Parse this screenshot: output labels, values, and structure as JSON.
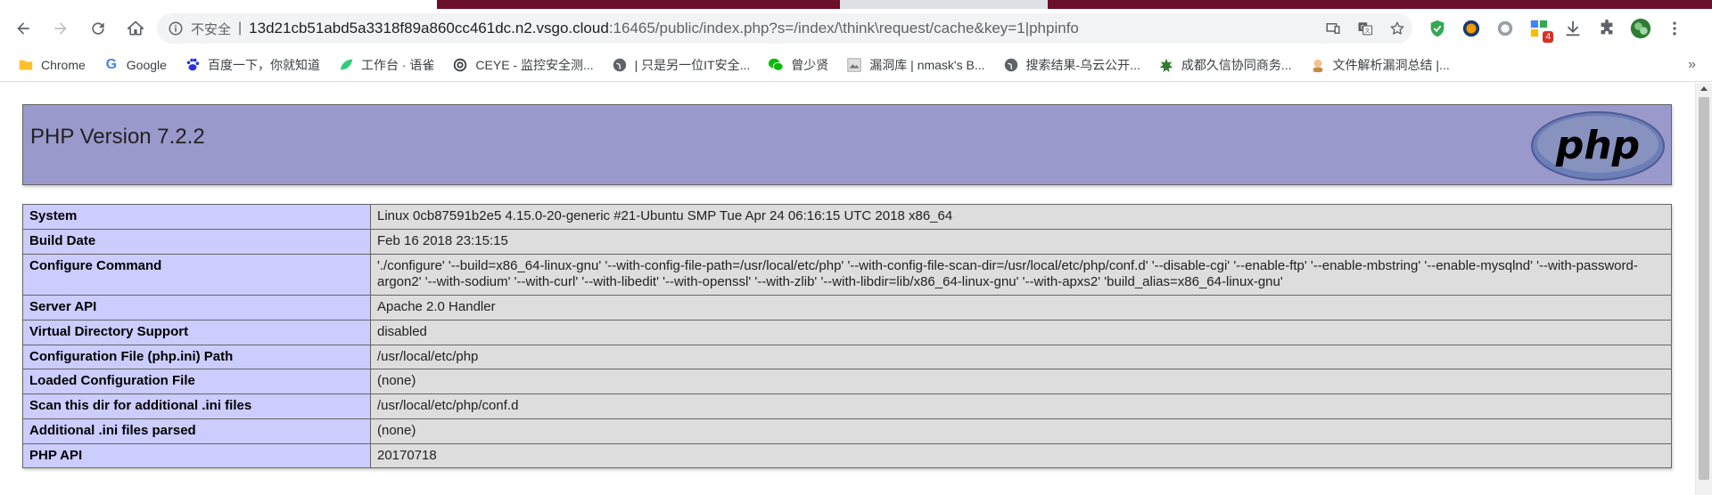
{
  "browser": {
    "security_label": "不安全",
    "url_host": "13d21cb51abd5a3318f89a860cc461dc.n2.vsgo.cloud",
    "url_rest": ":16465/public/index.php?s=/index/\\think\\request/cache&key=1|phpinfo",
    "extension_badge": "4",
    "accent_color": "#6b0f2a"
  },
  "bookmarks": [
    {
      "label": "Chrome",
      "icon": "folder-icon"
    },
    {
      "label": "Google",
      "icon": "google-icon"
    },
    {
      "label": "百度一下，你就知道",
      "icon": "baidu-icon"
    },
    {
      "label": "工作台 · 语雀",
      "icon": "yuque-icon"
    },
    {
      "label": "CEYE - 监控安全测...",
      "icon": "ceye-icon"
    },
    {
      "label": "| 只是另一位IT安全...",
      "icon": "globe-icon"
    },
    {
      "label": "曾少贤",
      "icon": "wechat-icon"
    },
    {
      "label": "漏洞库 | nmask's B...",
      "icon": "page-icon"
    },
    {
      "label": "搜索结果-乌云公开...",
      "icon": "globe-icon"
    },
    {
      "label": "成都久信协同商务...",
      "icon": "leaf-icon"
    },
    {
      "label": "文件解析漏洞总结 |...",
      "icon": "avatar-icon"
    }
  ],
  "bookmarks_more": "»",
  "php": {
    "title": "PHP Version 7.2.2",
    "logo_text": "php",
    "header_color": "#9999cc",
    "rows": [
      {
        "key": "System",
        "value": "Linux 0cb87591b2e5 4.15.0-20-generic #21-Ubuntu SMP Tue Apr 24 06:16:15 UTC 2018 x86_64"
      },
      {
        "key": "Build Date",
        "value": "Feb 16 2018 23:15:15"
      },
      {
        "key": "Configure Command",
        "value": "'./configure' '--build=x86_64-linux-gnu' '--with-config-file-path=/usr/local/etc/php' '--with-config-file-scan-dir=/usr/local/etc/php/conf.d' '--disable-cgi' '--enable-ftp' '--enable-mbstring' '--enable-mysqlnd' '--with-password-argon2' '--with-sodium' '--with-curl' '--with-libedit' '--with-openssl' '--with-zlib' '--with-libdir=lib/x86_64-linux-gnu' '--with-apxs2' 'build_alias=x86_64-linux-gnu'"
      },
      {
        "key": "Server API",
        "value": "Apache 2.0 Handler"
      },
      {
        "key": "Virtual Directory Support",
        "value": "disabled"
      },
      {
        "key": "Configuration File (php.ini) Path",
        "value": "/usr/local/etc/php"
      },
      {
        "key": "Loaded Configuration File",
        "value": "(none)"
      },
      {
        "key": "Scan this dir for additional .ini files",
        "value": "/usr/local/etc/php/conf.d"
      },
      {
        "key": "Additional .ini files parsed",
        "value": "(none)"
      },
      {
        "key": "PHP API",
        "value": "20170718"
      }
    ]
  }
}
